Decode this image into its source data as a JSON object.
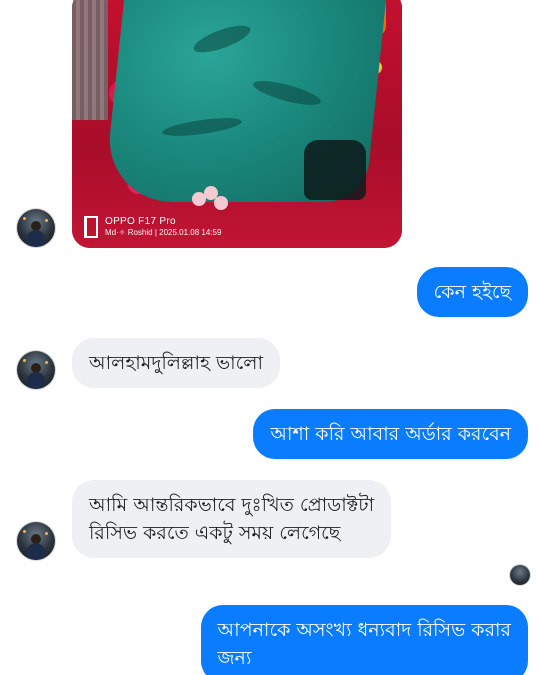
{
  "photo_message": {
    "watermark_model": "OPPO F17 Pro",
    "watermark_meta": "Md·✧ Roshid | 2025.01.08 14:59"
  },
  "messages": [
    {
      "direction": "out",
      "text": "কেন হইছে"
    },
    {
      "direction": "in",
      "text": "আলহামদুলিল্লাহ ভালো"
    },
    {
      "direction": "out",
      "text": "আশা করি আবার অর্ডার করবেন"
    },
    {
      "direction": "in",
      "text": "আমি আন্তরিকভাবে দুঃখিত প্রোডাক্টটা\nরিসিভ করতে একটু সময় লেগেছে"
    },
    {
      "direction": "out",
      "text": "আপনাকে অসংখ্য ধন্যবাদ রিসিভ করার\nজন্য"
    }
  ],
  "colors": {
    "outgoing_bubble": "#0a7cff",
    "incoming_bubble": "#eef0f3",
    "outgoing_text": "#ffffff",
    "incoming_text": "#1c1e21"
  }
}
